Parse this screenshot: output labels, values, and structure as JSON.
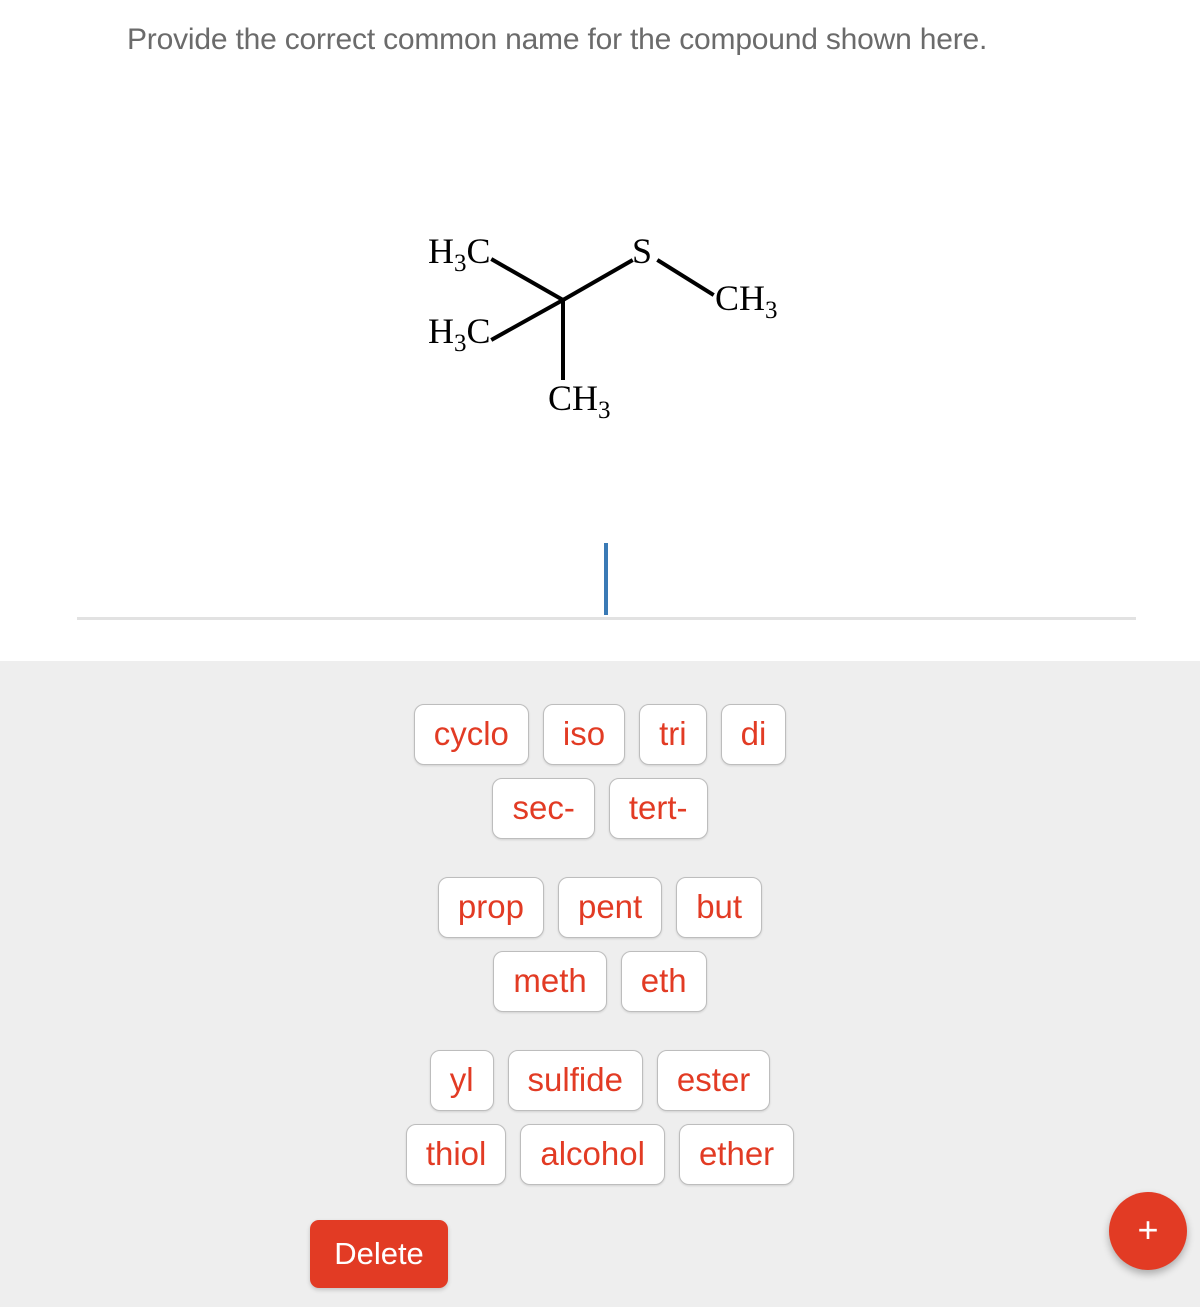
{
  "question": {
    "prompt": "Provide the correct common name for the compound shown here."
  },
  "molecule": {
    "name": "tert-butyl methyl sulfide structure",
    "labels": {
      "top_left": "H3C",
      "bottom_left": "H3C",
      "bottom_center": "CH3",
      "heteroatom": "S",
      "right": "CH3"
    },
    "label_top_left_main": "H",
    "label_top_left_sub": "3",
    "label_top_left_tail": "C",
    "sulfur": "S",
    "ch_main": "CH",
    "ch_sub": "3",
    "bond_color": "#000000"
  },
  "answer": {
    "value": "",
    "placeholder": "",
    "caret_color": "#3a7ab5",
    "underline_color": "#e2e2e2"
  },
  "tokens": {
    "prefix_row_1": [
      {
        "label": "cyclo"
      },
      {
        "label": "iso"
      },
      {
        "label": "tri"
      },
      {
        "label": "di"
      }
    ],
    "prefix_row_2": [
      {
        "label": "sec-"
      },
      {
        "label": "tert-"
      }
    ],
    "stem_row_1": [
      {
        "label": "prop"
      },
      {
        "label": "pent"
      },
      {
        "label": "but"
      }
    ],
    "stem_row_2": [
      {
        "label": "meth"
      },
      {
        "label": "eth"
      }
    ],
    "suffix_row_1": [
      {
        "label": "yl"
      },
      {
        "label": "sulfide"
      },
      {
        "label": "ester"
      }
    ],
    "suffix_row_2": [
      {
        "label": "thiol"
      },
      {
        "label": "alcohol"
      },
      {
        "label": "ether"
      }
    ]
  },
  "actions": {
    "delete_label": "Delete",
    "add_label": "+"
  },
  "colors": {
    "accent_red": "#e23b24",
    "token_text": "#e23b24",
    "panel_bg": "#eeeeee",
    "page_bg": "#ffffff",
    "prompt_text": "#6b6b6b"
  }
}
